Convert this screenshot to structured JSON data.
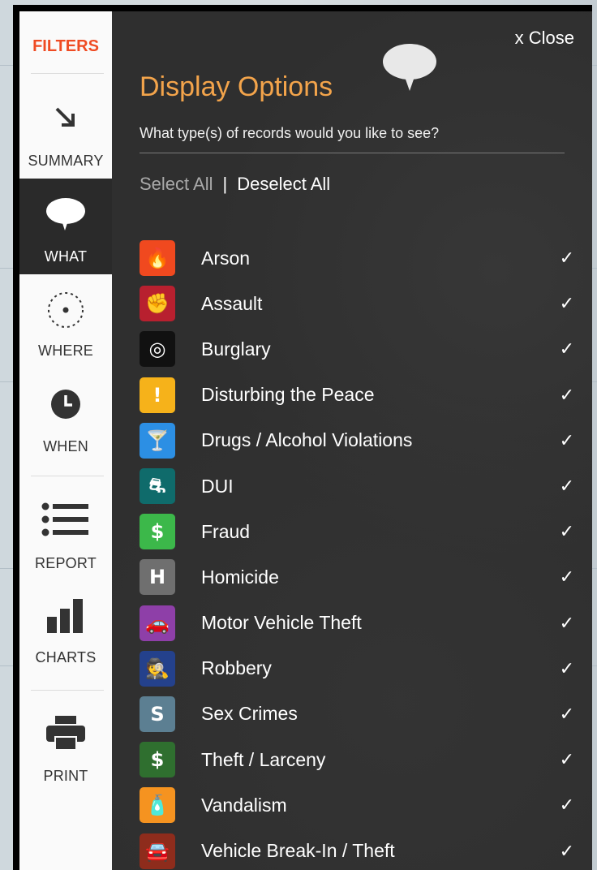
{
  "sidebar": {
    "filters_label": "FILTERS",
    "items": [
      {
        "id": "summary",
        "label": "SUMMARY",
        "icon": "arrow-down-right-icon",
        "active": false
      },
      {
        "id": "what",
        "label": "WHAT",
        "icon": "speech-bubble-icon",
        "active": true
      },
      {
        "id": "where",
        "label": "WHERE",
        "icon": "dotted-circle-icon",
        "active": false
      },
      {
        "id": "when",
        "label": "WHEN",
        "icon": "clock-icon",
        "active": false
      },
      {
        "id": "report",
        "label": "REPORT",
        "icon": "list-icon",
        "active": false
      },
      {
        "id": "charts",
        "label": "CHARTS",
        "icon": "bar-chart-icon",
        "active": false
      },
      {
        "id": "print",
        "label": "PRINT",
        "icon": "printer-icon",
        "active": false
      }
    ]
  },
  "panel": {
    "close_label": "x Close",
    "title": "Display Options",
    "question": "What type(s) of records would you like to see?",
    "select_all": "Select All",
    "divider": "|",
    "deselect_all": "Deselect All",
    "check_glyph": "✓"
  },
  "records": [
    {
      "label": "Arson",
      "color": "#f0491f",
      "glyph": "🔥",
      "icon": "flame-icon",
      "checked": true
    },
    {
      "label": "Assault",
      "color": "#b8202f",
      "glyph": "✊",
      "icon": "fist-icon",
      "checked": true
    },
    {
      "label": "Burglary",
      "color": "#111111",
      "glyph": "◎",
      "icon": "mask-icon",
      "checked": true
    },
    {
      "label": "Disturbing the Peace",
      "color": "#f6b21a",
      "glyph": "!",
      "icon": "exclamation-icon",
      "checked": true
    },
    {
      "label": "Drugs / Alcohol Violations",
      "color": "#2c8fe4",
      "glyph": "🍸",
      "icon": "cocktail-icon",
      "checked": true
    },
    {
      "label": "DUI",
      "color": "#0f6b6b",
      "glyph": "⛐",
      "icon": "car-swerve-icon",
      "checked": true
    },
    {
      "label": "Fraud",
      "color": "#3cb84a",
      "glyph": "$",
      "icon": "credit-card-icon",
      "checked": true
    },
    {
      "label": "Homicide",
      "color": "#6f6f6f",
      "glyph": "H",
      "icon": "homicide-icon",
      "checked": true
    },
    {
      "label": "Motor Vehicle Theft",
      "color": "#8e3fa8",
      "glyph": "🚗",
      "icon": "car-icon",
      "checked": true
    },
    {
      "label": "Robbery",
      "color": "#24418c",
      "glyph": "🕵",
      "icon": "masked-robber-icon",
      "checked": true
    },
    {
      "label": "Sex Crimes",
      "color": "#5c7f92",
      "glyph": "S",
      "icon": "letter-s-icon",
      "checked": true
    },
    {
      "label": "Theft / Larceny",
      "color": "#2f6f2f",
      "glyph": "$",
      "icon": "dollar-icon",
      "checked": true
    },
    {
      "label": "Vandalism",
      "color": "#f59320",
      "glyph": "🧴",
      "icon": "spray-can-icon",
      "checked": true
    },
    {
      "label": "Vehicle Break-In / Theft",
      "color": "#8e2c1c",
      "glyph": "🚘",
      "icon": "car-break-in-icon",
      "checked": true
    }
  ]
}
